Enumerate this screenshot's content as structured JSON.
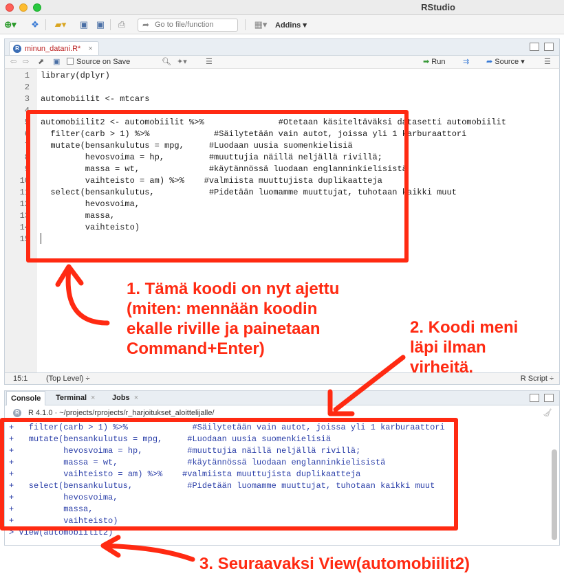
{
  "window": {
    "title": "RStudio"
  },
  "toolbar": {
    "goto_placeholder": "Go to file/function",
    "addins_label": "Addins"
  },
  "editor": {
    "file_tab": "minun_datani.R*",
    "source_on_save": "Source on Save",
    "run_label": "Run",
    "source_label": "Source",
    "lines": [
      {
        "n": "1",
        "text": "library(dplyr)"
      },
      {
        "n": "2",
        "text": ""
      },
      {
        "n": "3",
        "text": "automobiilit <- mtcars"
      },
      {
        "n": "4",
        "text": ""
      },
      {
        "n": "5",
        "text": "automobiilit2 <- automobiilit %>%               #Otetaan käsiteltäväksi datasetti automobiilit"
      },
      {
        "n": "6",
        "text": "  filter(carb > 1) %>%             #Säilytetään vain autot, joissa yli 1 karburaattori"
      },
      {
        "n": "7",
        "text": "  mutate(bensankulutus = mpg,     #Luodaan uusia suomenkielisiä"
      },
      {
        "n": "8",
        "text": "         hevosvoima = hp,         #muuttujia näillä neljällä rivillä;"
      },
      {
        "n": "9",
        "text": "         massa = wt,              #käytännössä luodaan englanninkielisistä"
      },
      {
        "n": "10",
        "text": "         vaihteisto = am) %>%    #valmiista muuttujista duplikaatteja"
      },
      {
        "n": "11",
        "text": "  select(bensankulutus,           #Pidetään luomamme muuttujat, tuhotaan kaikki muut"
      },
      {
        "n": "12",
        "text": "         hevosvoima,"
      },
      {
        "n": "13",
        "text": "         massa,"
      },
      {
        "n": "14",
        "text": "         vaihteisto)"
      },
      {
        "n": "15",
        "text": ""
      }
    ],
    "status_position": "15:1",
    "status_scope": "(Top Level) ÷",
    "status_type": "R Script ÷"
  },
  "console": {
    "tabs": [
      "Console",
      "Terminal",
      "Jobs"
    ],
    "path": "R 4.1.0 · ~/projects/rprojects/r_harjoitukset_aloittelijalle/",
    "lines": [
      "+   filter(carb > 1) %>%             #Säilytetään vain autot, joissa yli 1 karburaattori",
      "+   mutate(bensankulutus = mpg,     #Luodaan uusia suomenkielisiä",
      "+          hevosvoima = hp,         #muuttujia näillä neljällä rivillä;",
      "+          massa = wt,              #käytännössä luodaan englanninkielisistä",
      "+          vaihteisto = am) %>%    #valmiista muuttujista duplikaatteja",
      "+   select(bensankulutus,           #Pidetään luomamme muuttujat, tuhotaan kaikki muut",
      "+          hevosvoima,",
      "+          massa,",
      "+          vaihteisto)",
      "> View(automobiilit2)"
    ]
  },
  "annotations": {
    "note1": "1. Tämä koodi on nyt ajettu\n(miten: mennään koodin\nekalle riville ja painetaan\nCommand+Enter)",
    "note2": "2. Koodi meni\nläpi ilman\nvirheitä.",
    "note3": "3. Seuraavaksi View(automobiilit2)"
  },
  "colors": {
    "annotation": "#ff2a12",
    "console_text": "#2a3ea8"
  }
}
